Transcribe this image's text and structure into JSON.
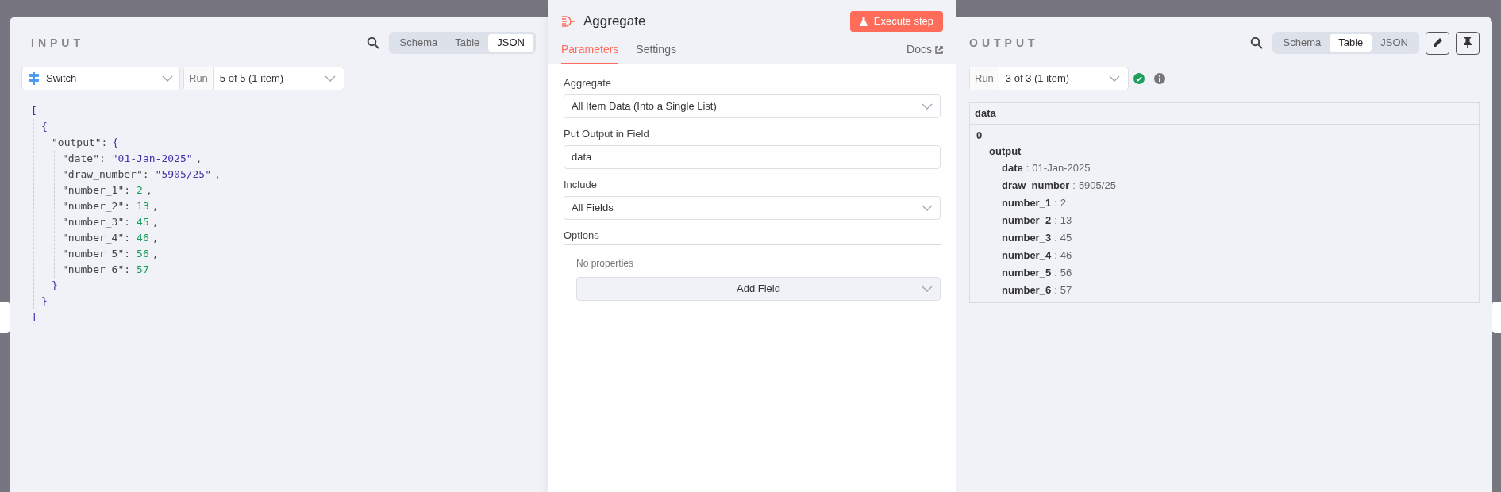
{
  "input": {
    "title": "INPUT",
    "views": [
      {
        "label": "Schema",
        "selected": false
      },
      {
        "label": "Table",
        "selected": false
      },
      {
        "label": "JSON",
        "selected": true
      }
    ],
    "node_select": {
      "value": "Switch"
    },
    "run_select": {
      "label": "Run",
      "value": "5 of 5 (1 item)"
    },
    "json_view": {
      "open": "[",
      "close": "]",
      "children": [
        {
          "open": "{",
          "close": "}",
          "children": [
            {
              "key": "\"output\":",
              "open": "{",
              "close": "}",
              "children": [
                {
                  "key": "\"date\":",
                  "value": "\"01-Jan-2025\"",
                  "kind": "string",
                  "comma": ","
                },
                {
                  "key": "\"draw_number\":",
                  "value": "\"5905/25\"",
                  "kind": "string",
                  "comma": ","
                },
                {
                  "key": "\"number_1\":",
                  "value": "2",
                  "kind": "number",
                  "comma": ","
                },
                {
                  "key": "\"number_2\":",
                  "value": "13",
                  "kind": "number",
                  "comma": ","
                },
                {
                  "key": "\"number_3\":",
                  "value": "45",
                  "kind": "number",
                  "comma": ","
                },
                {
                  "key": "\"number_4\":",
                  "value": "46",
                  "kind": "number",
                  "comma": ","
                },
                {
                  "key": "\"number_5\":",
                  "value": "56",
                  "kind": "number",
                  "comma": ","
                },
                {
                  "key": "\"number_6\":",
                  "value": "57",
                  "kind": "number"
                }
              ]
            }
          ]
        }
      ]
    }
  },
  "node": {
    "title": "Aggregate",
    "execute_button": "Execute step",
    "tabs": [
      {
        "label": "Parameters",
        "selected": true
      },
      {
        "label": "Settings",
        "selected": false
      }
    ],
    "docs_link": "Docs",
    "fields": [
      {
        "kind": "select",
        "label": "Aggregate",
        "value": "All Item Data (Into a Single List)"
      },
      {
        "kind": "text",
        "label": "Put Output in Field",
        "value": "data"
      },
      {
        "kind": "select",
        "label": "Include",
        "value": "All Fields"
      }
    ],
    "options": {
      "label": "Options",
      "empty_text": "No properties",
      "add_button": "Add Field"
    }
  },
  "output": {
    "title": "OUTPUT",
    "views": [
      {
        "label": "Schema",
        "selected": false
      },
      {
        "label": "Table",
        "selected": true
      },
      {
        "label": "JSON",
        "selected": false
      }
    ],
    "run_select": {
      "label": "Run",
      "value": "3 of 3 (1 item)"
    },
    "table": {
      "column": "data",
      "root": {
        "label": "0",
        "children": [
          {
            "label": "output",
            "children": [
              {
                "key": "date",
                "sep": ":",
                "value": "01-Jan-2025"
              },
              {
                "key": "draw_number",
                "sep": ":",
                "value": "5905/25"
              },
              {
                "key": "number_1",
                "sep": ":",
                "value": "2"
              },
              {
                "key": "number_2",
                "sep": ":",
                "value": "13"
              },
              {
                "key": "number_3",
                "sep": ":",
                "value": "45"
              },
              {
                "key": "number_4",
                "sep": ":",
                "value": "46"
              },
              {
                "key": "number_5",
                "sep": ":",
                "value": "56"
              },
              {
                "key": "number_6",
                "sep": ":",
                "value": "57"
              }
            ]
          }
        ]
      }
    }
  }
}
